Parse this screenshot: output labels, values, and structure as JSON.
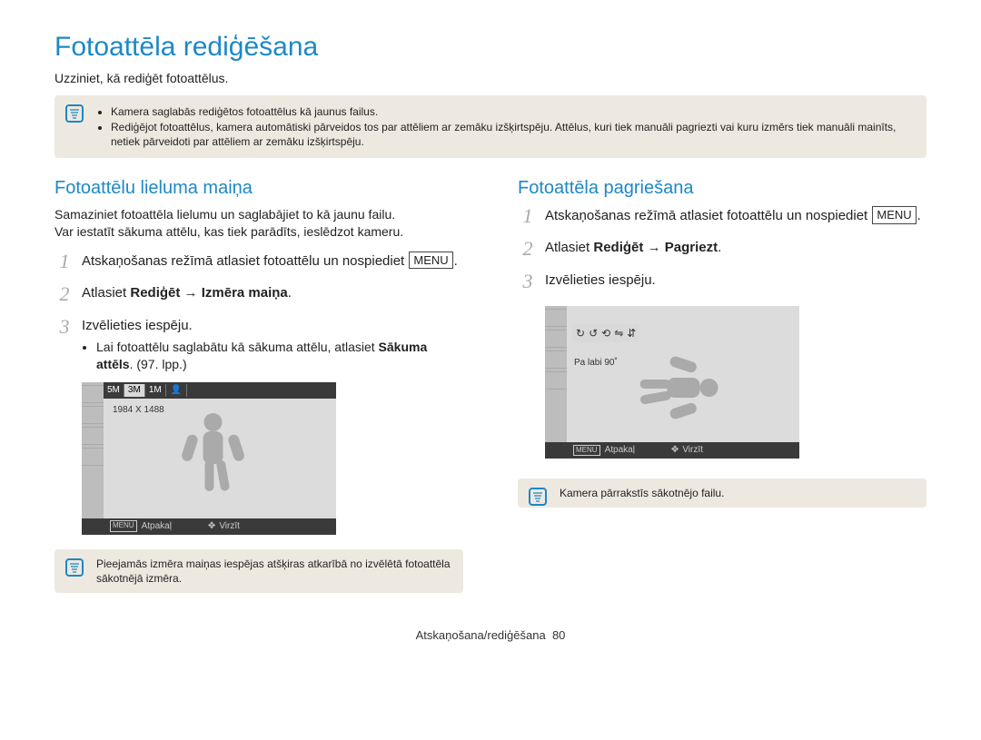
{
  "title": "Fotoattēla rediģēšana",
  "subtitle": "Uzziniet, kā rediģēt fotoattēlus.",
  "top_notes": [
    "Kamera saglabās rediģētos fotoattēlus kā jaunus failus.",
    "Rediģējot fotoattēlus, kamera automātiski pārveidos tos par attēliem ar zemāku izšķirtspēju. Attēlus, kuri tiek manuāli pagriezti vai kuru izmērs tiek manuāli mainīts, netiek pārveidoti par attēliem ar zemāku izšķirtspēju."
  ],
  "left": {
    "heading": "Fotoattēlu lieluma maiņa",
    "intro1": "Samaziniet fotoattēla lielumu un saglabājiet to kā jaunu failu.",
    "intro2": "Var iestatīt sākuma attēlu, kas tiek parādīts, ieslēdzot kameru.",
    "steps": {
      "n1": "1",
      "s1a": "Atskaņošanas režīmā atlasiet fotoattēlu un nospiediet",
      "menu": "MENU",
      "s1b": ".",
      "n2": "2",
      "s2a": "Atlasiet ",
      "s2b": "Rediģēt",
      "s2c": " → ",
      "s2d": "Izmēra maiņa",
      "s2e": ".",
      "n3": "3",
      "s3": "Izvēlieties iespēju.",
      "bullet_pre": "Lai fotoattēlu saglabātu kā sākuma attēlu, atlasiet ",
      "bullet_bold": "Sākuma attēls",
      "bullet_post": ". (97. lpp.)"
    },
    "shot": {
      "dim": "1984 X 1488",
      "chips": [
        "5M",
        "3M",
        "1M"
      ],
      "back": "Atpakaļ",
      "move": "Virzīt",
      "menu_lbl": "MENU"
    },
    "note": "Pieejamās izmēra maiņas iespējas atšķiras atkarībā no izvēlētā fotoattēla sākotnējā izmēra."
  },
  "right": {
    "heading": "Fotoattēla pagriešana",
    "steps": {
      "n1": "1",
      "s1a": "Atskaņošanas režīmā atlasiet fotoattēlu un nospiediet",
      "menu": "MENU",
      "s1b": ".",
      "n2": "2",
      "s2a": "Atlasiet ",
      "s2b": "Rediģēt",
      "s2c": " → ",
      "s2d": "Pagriezt",
      "s2e": ".",
      "n3": "3",
      "s3": "Izvēlieties iespēju."
    },
    "shot": {
      "rotlabel": "Pa labi 90˚",
      "back": "Atpakaļ",
      "move": "Virzīt",
      "menu_lbl": "MENU"
    },
    "note": "Kamera pārrakstīs sākotnējo failu."
  },
  "footer_label": "Atskaņošana/rediģēšana",
  "footer_num": "80"
}
